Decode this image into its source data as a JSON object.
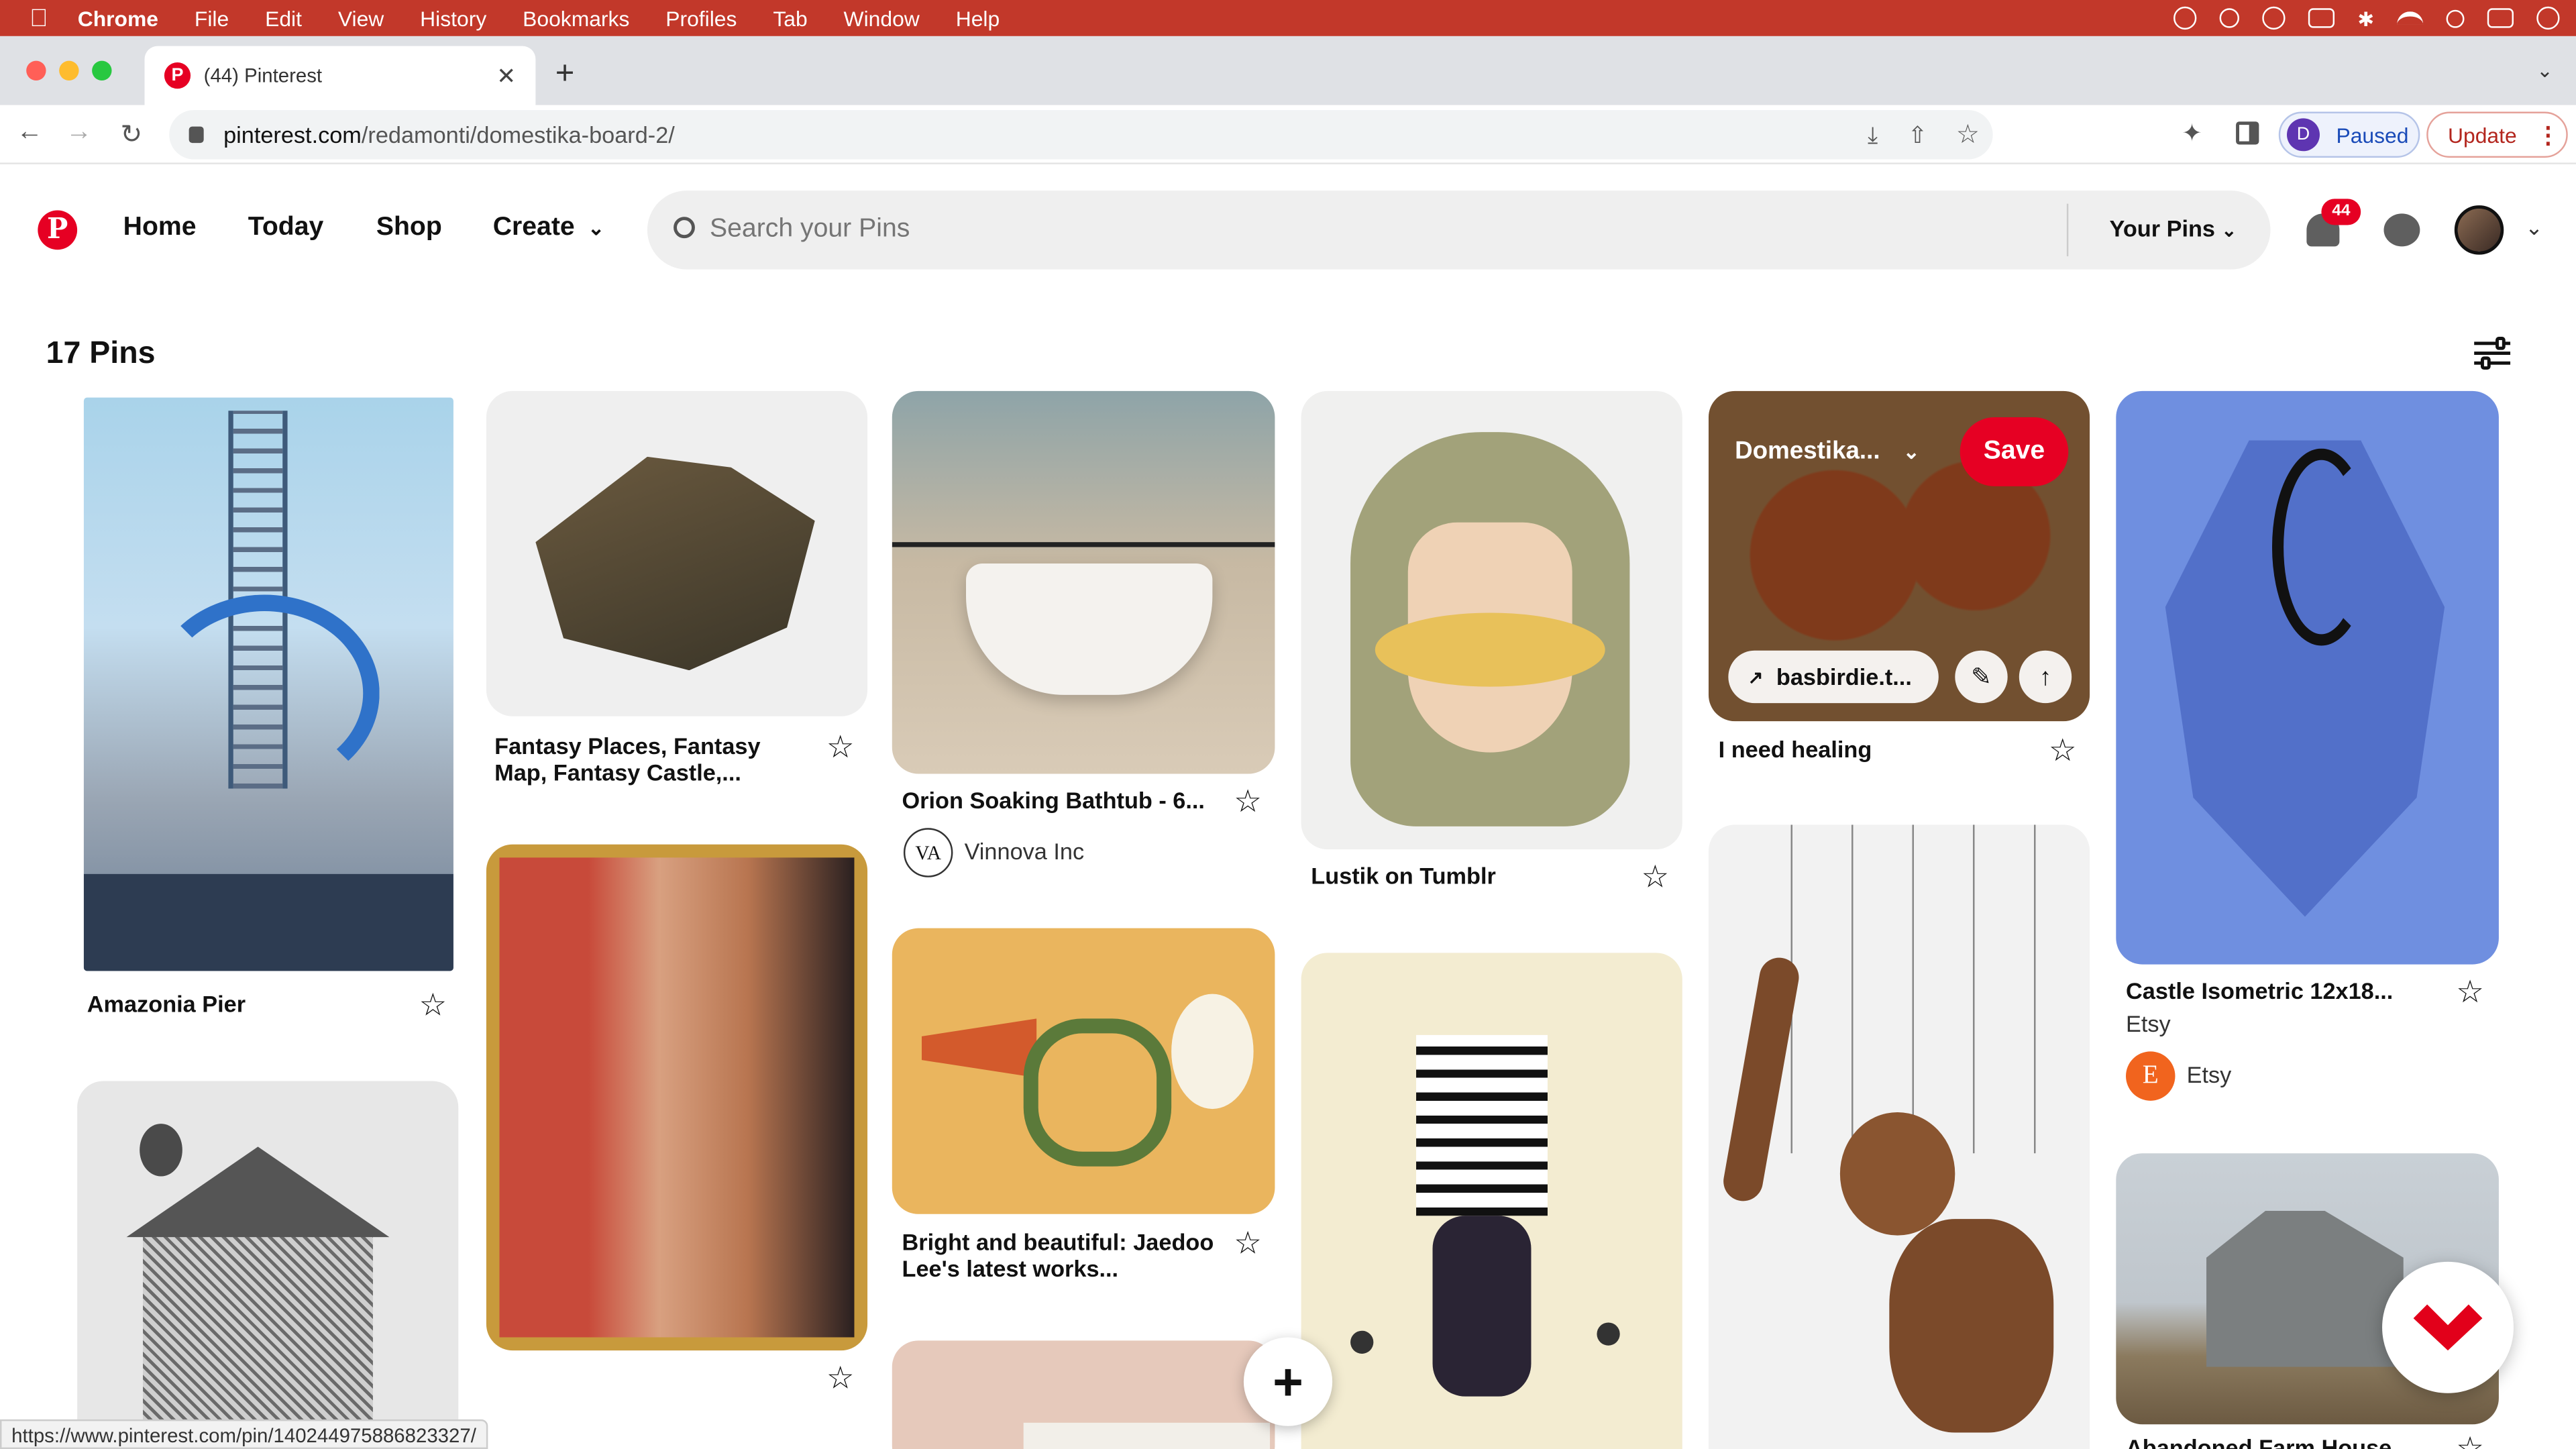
{
  "menubar": {
    "app": "Chrome",
    "items": [
      "File",
      "Edit",
      "View",
      "History",
      "Bookmarks",
      "Profiles",
      "Tab",
      "Window",
      "Help"
    ]
  },
  "browser": {
    "tab_title": "(44) Pinterest",
    "url_domain": "pinterest.com",
    "url_path": "/redamonti/domestika-board-2/",
    "profile_initial": "D",
    "profile_status": "Paused",
    "update_label": "Update",
    "status_url": "https://www.pinterest.com/pin/140244975886823327/"
  },
  "header": {
    "nav": [
      "Home",
      "Today",
      "Shop",
      "Create"
    ],
    "search_placeholder": "Search your Pins",
    "your_pins": "Your Pins",
    "notif_count": "44"
  },
  "board": {
    "pin_count": "17 Pins"
  },
  "pins": {
    "amazonia": {
      "title": "Amazonia Pier"
    },
    "fantasy": {
      "title": "Fantasy Places, Fantasy Map, Fantasy Castle,..."
    },
    "orion": {
      "title": "Orion Soaking Bathtub - 6...",
      "creator": "Vinnova Inc",
      "creator_initials": "VA"
    },
    "bright": {
      "title": "Bright and beautiful: Jaedoo Lee's latest works..."
    },
    "lustik": {
      "title": "Lustik on Tumblr"
    },
    "healing": {
      "title": "I need healing",
      "board": "Domestika...",
      "save": "Save",
      "link": "basbirdie.t..."
    },
    "castle": {
      "title": "Castle Isometric 12x18...",
      "source": "Etsy",
      "creator": "Etsy",
      "creator_initial": "E"
    },
    "farm": {
      "title": "Abandoned Farm House"
    }
  },
  "colors": {
    "accent": "#e60023",
    "menubar": "#c2382a"
  }
}
